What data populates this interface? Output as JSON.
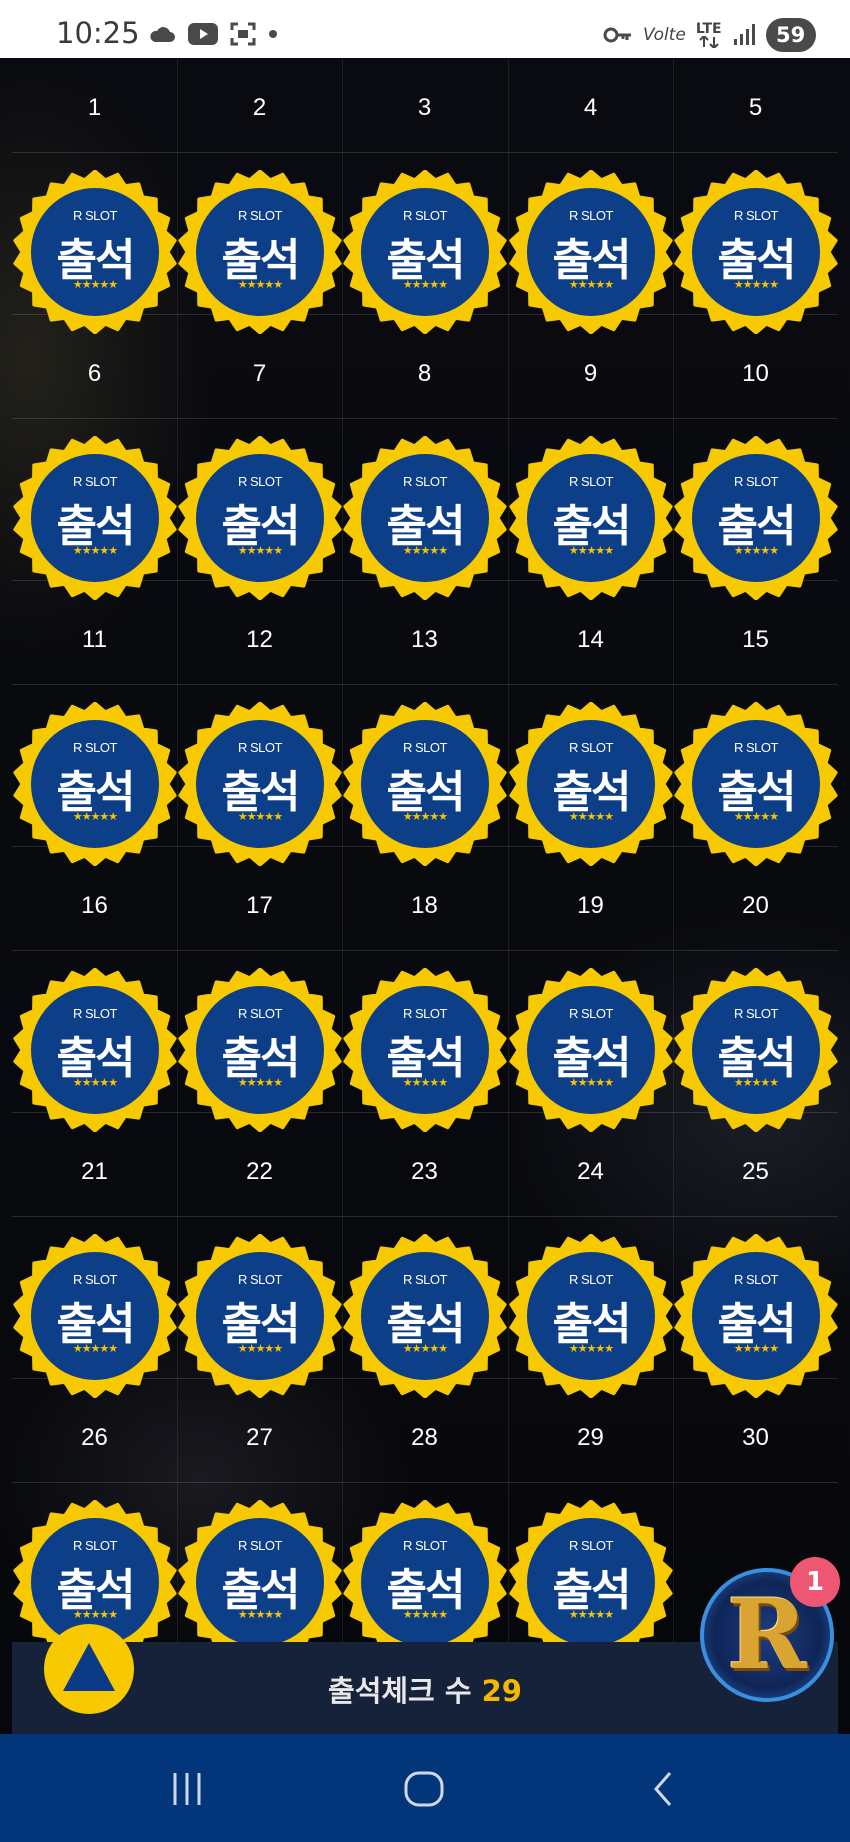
{
  "status_bar": {
    "time": "10:25",
    "left_icons": [
      "cloud-icon",
      "youtube-icon",
      "screenshot-icon",
      "dot-icon"
    ],
    "right_icons": [
      "vpn-key-icon",
      "volte-icon",
      "lte-icon",
      "signal-icon"
    ],
    "volte": "Volte",
    "lte": "LTE",
    "battery": "59"
  },
  "calendar": {
    "days": [
      {
        "day": "1",
        "stamped": true
      },
      {
        "day": "2",
        "stamped": true
      },
      {
        "day": "3",
        "stamped": true
      },
      {
        "day": "4",
        "stamped": true
      },
      {
        "day": "5",
        "stamped": true
      },
      {
        "day": "6",
        "stamped": true
      },
      {
        "day": "7",
        "stamped": true
      },
      {
        "day": "8",
        "stamped": true
      },
      {
        "day": "9",
        "stamped": true
      },
      {
        "day": "10",
        "stamped": true
      },
      {
        "day": "11",
        "stamped": true
      },
      {
        "day": "12",
        "stamped": true
      },
      {
        "day": "13",
        "stamped": true
      },
      {
        "day": "14",
        "stamped": true
      },
      {
        "day": "15",
        "stamped": true
      },
      {
        "day": "16",
        "stamped": true
      },
      {
        "day": "17",
        "stamped": true
      },
      {
        "day": "18",
        "stamped": true
      },
      {
        "day": "19",
        "stamped": true
      },
      {
        "day": "20",
        "stamped": true
      },
      {
        "day": "21",
        "stamped": true
      },
      {
        "day": "22",
        "stamped": true
      },
      {
        "day": "23",
        "stamped": true
      },
      {
        "day": "24",
        "stamped": true
      },
      {
        "day": "25",
        "stamped": true
      },
      {
        "day": "26",
        "stamped": true
      },
      {
        "day": "27",
        "stamped": true
      },
      {
        "day": "28",
        "stamped": true
      },
      {
        "day": "29",
        "stamped": true
      },
      {
        "day": "30",
        "stamped": false
      }
    ],
    "badge": {
      "brand": "R SLOT",
      "title": "출석",
      "stars": "★★★★★"
    },
    "colors": {
      "badge_ring": "#f7c900",
      "badge_fill": "#0c3f88"
    }
  },
  "footer": {
    "label": "출석체크 수",
    "count": "29",
    "count_color": "#f5b800",
    "top_button_icon": "triangle-up-icon"
  },
  "floating_widget": {
    "letter": "R",
    "notification_count": "1"
  },
  "nav_bar": {
    "recents_icon": "recents-icon",
    "home_icon": "home-icon",
    "back_icon": "back-icon"
  }
}
